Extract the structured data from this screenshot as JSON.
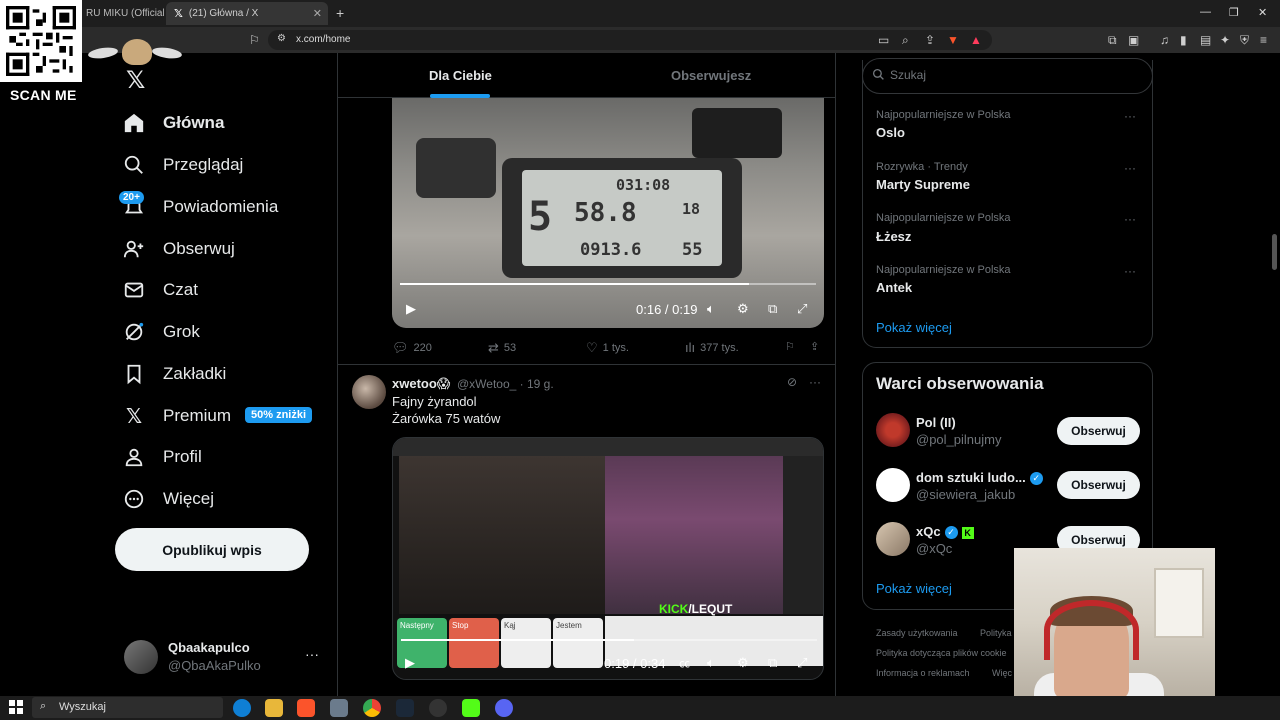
{
  "browser": {
    "tabs": [
      {
        "label": "RU MIKU (Official Vid"
      },
      {
        "label": "(21) Główna / X"
      }
    ],
    "url": "x.com/home"
  },
  "overlay": {
    "scan_label": "SCAN ME"
  },
  "nav": {
    "items": [
      {
        "label": "Główna"
      },
      {
        "label": "Przeglądaj"
      },
      {
        "label": "Powiadomienia"
      },
      {
        "label": "Obserwuj"
      },
      {
        "label": "Czat"
      },
      {
        "label": "Grok"
      },
      {
        "label": "Zakładki"
      },
      {
        "label": "Premium"
      },
      {
        "label": "Profil"
      },
      {
        "label": "Więcej"
      }
    ],
    "notifications_badge": "20+",
    "premium_badge": "50% zniżki",
    "post_button": "Opublikuj wpis",
    "account": {
      "name": "Qbaakapulco",
      "handle": "@QbaAkaPulko"
    }
  },
  "feed": {
    "tabs": {
      "for_you": "Dla Ciebie",
      "following": "Obserwujesz"
    },
    "tweet1": {
      "video": {
        "time": "0:16 / 0:19",
        "progress": 0.84,
        "lcd_top": "031:08",
        "lcd_speed": "58.8",
        "lcd_odo": "0913.6",
        "lcd_gear": "5",
        "lcd_right": "18",
        "lcd_right2": "55"
      },
      "stats": {
        "replies": "220",
        "reposts": "53",
        "likes": "1 tys.",
        "views": "377 tys."
      }
    },
    "tweet2": {
      "name": "xwetoo😱",
      "handle": "@xWetoo_ · 19 g.",
      "line1": "Fajny żyrandol",
      "line2": "Żarówka 75 watów",
      "video": {
        "time": "0:19 / 0:34",
        "progress": 0.56,
        "kick_a": "KICK",
        "kick_b": "/LEQUT",
        "btn1": "Następny",
        "btn2": "Stop",
        "btn3": "Kąj",
        "btn4": "Jestem"
      }
    }
  },
  "sidebar": {
    "search_placeholder": "Szukaj",
    "trends": [
      {
        "context": "Najpopularniejsze w Polska",
        "name": "Oslo"
      },
      {
        "context": "Rozrywka · Trendy",
        "name": "Marty Supreme"
      },
      {
        "context": "Najpopularniejsze w Polska",
        "name": "Łżesz"
      },
      {
        "context": "Najpopularniejsze w Polska",
        "name": "Antek"
      }
    ],
    "show_more": "Pokaż więcej",
    "who_to_follow": {
      "title": "Warci obserwowania",
      "accounts": [
        {
          "name": "Pol (II)",
          "handle": "@pol_pilnujmy",
          "button": "Obserwuj"
        },
        {
          "name": "dom sztuki ludo...",
          "handle": "@siewiera_jakub",
          "button": "Obserwuj"
        },
        {
          "name": "xQc",
          "handle": "@xQc",
          "button": "Obserwuj"
        }
      ],
      "show_more": "Pokaż więcej"
    },
    "footer": [
      "Zasady użytkowania",
      "Polityka",
      "Polityka dotycząca plików cookie",
      "Informacja o reklamach",
      "Więc"
    ]
  },
  "taskbar": {
    "search": "Wyszukaj"
  },
  "colors": {
    "accent": "#1d9bf0",
    "background": "#000000",
    "text": "#e7e9ea",
    "muted": "#71767b",
    "kick": "#53fc18"
  }
}
